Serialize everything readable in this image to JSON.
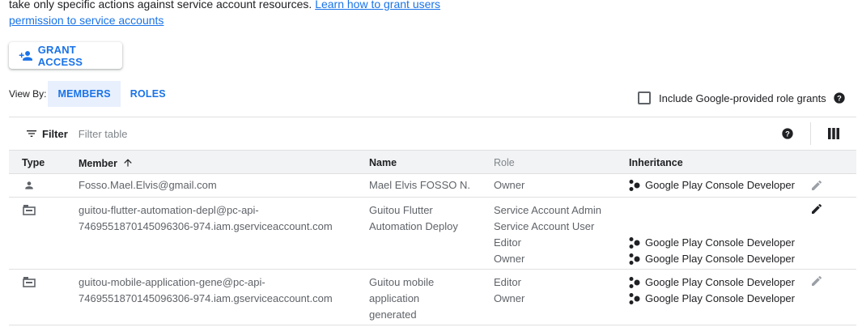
{
  "intro": {
    "text": "take only specific actions against service account resources. ",
    "link": "Learn how to grant users permission to service accounts"
  },
  "grant_button": {
    "label": "GRANT ACCESS",
    "icon": "person-add-icon"
  },
  "view_by": {
    "label": "View By:",
    "tabs": [
      {
        "label": "MEMBERS",
        "active": true
      },
      {
        "label": "ROLES",
        "active": false
      }
    ]
  },
  "include_google": {
    "label": "Include Google-provided role grants",
    "checked": false
  },
  "filter": {
    "label": "Filter",
    "placeholder": "Filter table"
  },
  "table": {
    "headers": {
      "type": "Type",
      "member": "Member",
      "name": "Name",
      "role": "Role",
      "inheritance": "Inheritance"
    },
    "rows": [
      {
        "type_icon": "person-icon",
        "member": "Fosso.Mael.Elvis@gmail.com",
        "name": "Mael Elvis FOSSO N.",
        "roles": [
          "Owner"
        ],
        "inheritance": [
          "Google Play Console Developer"
        ]
      },
      {
        "type_icon": "service-account-icon",
        "member": "guitou-flutter-automation-depl@pc-api-7469551870145096306-974.iam.gserviceaccount.com",
        "name": "Guitou Flutter Automation Deploy",
        "roles": [
          "Service Account Admin",
          "Service Account User",
          "Editor",
          "Owner"
        ],
        "inheritance": [
          "",
          "",
          "Google Play Console Developer",
          "Google Play Console Developer"
        ]
      },
      {
        "type_icon": "service-account-icon",
        "member": "guitou-mobile-application-gene@pc-api-7469551870145096306-974.iam.gserviceaccount.com",
        "name": "Guitou mobile application generated",
        "roles": [
          "Editor",
          "Owner"
        ],
        "inheritance": [
          "Google Play Console Developer",
          "Google Play Console Developer"
        ]
      }
    ]
  },
  "colors": {
    "accent": "#1a73e8",
    "header_bg": "#f1f3f4",
    "text_secondary": "#5f6368"
  }
}
